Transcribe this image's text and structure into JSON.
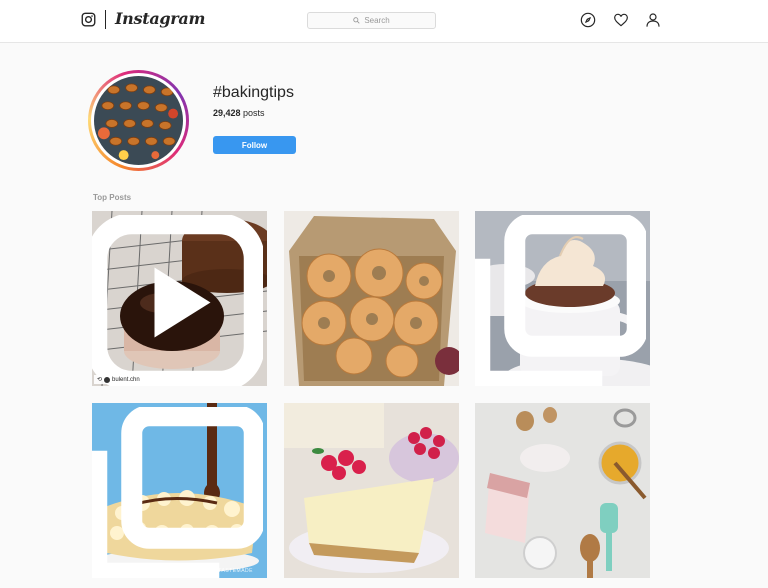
{
  "nav": {
    "logo_text": "Instagram",
    "search_placeholder": "Search",
    "icons": [
      "explore-compass-icon",
      "heart-icon",
      "profile-icon"
    ]
  },
  "header": {
    "hashtag": "#bakingtips",
    "post_count": "29,428",
    "post_count_label": "posts",
    "follow_label": "Follow"
  },
  "top_posts": {
    "label": "Top Posts",
    "posts": [
      {
        "subject": "chocolate glazed cake",
        "badge": "video-icon",
        "credit": "bulent.chn"
      },
      {
        "subject": "sugar donuts in paper bag"
      },
      {
        "subject": "cupcake in coffee cup",
        "badge": "carousel-icon"
      },
      {
        "subject": "popcorn cake with chocolate drizzle",
        "badge": "carousel-icon",
        "watermark": "TASTEMADE"
      },
      {
        "subject": "cheesecake with raspberries"
      },
      {
        "subject": "baking ingredients flat lay"
      }
    ]
  },
  "colors": {
    "accent": "#3897f0",
    "text": "#262626",
    "muted": "#999999",
    "background": "#fafafa"
  }
}
